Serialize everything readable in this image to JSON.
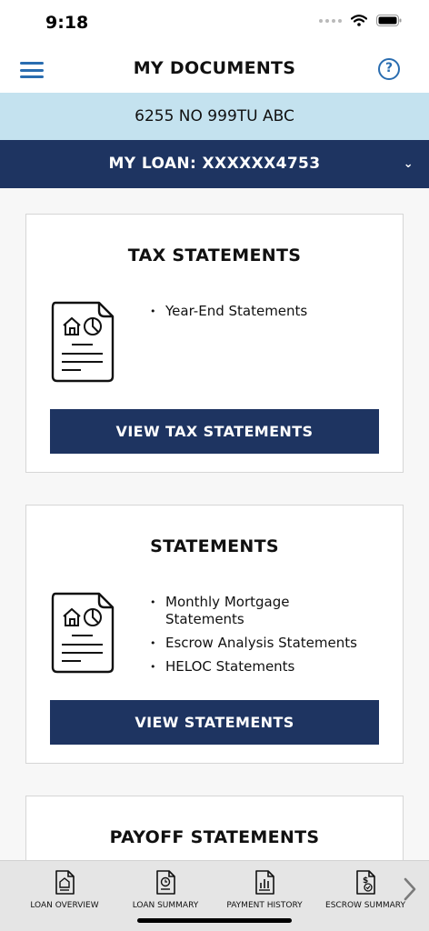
{
  "status_bar": {
    "time": "9:18"
  },
  "nav": {
    "title": "MY DOCUMENTS",
    "help_glyph": "?"
  },
  "address": "6255 NO 999TU ABC",
  "loan": {
    "label": "MY LOAN: XXXXXX4753",
    "chevron": "⌄"
  },
  "cards": [
    {
      "title": "TAX STATEMENTS",
      "items": [
        "Year-End Statements"
      ],
      "button": "VIEW TAX STATEMENTS"
    },
    {
      "title": "STATEMENTS",
      "items": [
        "Monthly Mortgage Statements",
        "Escrow Analysis Statements",
        "HELOC Statements"
      ],
      "button": "VIEW STATEMENTS"
    },
    {
      "title": "PAYOFF STATEMENTS"
    }
  ],
  "tab_bar": {
    "tabs": [
      {
        "label": "LOAN OVERVIEW",
        "icon": "home-document-icon"
      },
      {
        "label": "LOAN SUMMARY",
        "icon": "document-clock-icon"
      },
      {
        "label": "PAYMENT HISTORY",
        "icon": "document-chart-icon"
      },
      {
        "label": "ESCROW SUMMARY",
        "icon": "document-dollar-icon"
      }
    ],
    "next_icon": "chevron-right-icon"
  },
  "colors": {
    "navy": "#1e3461",
    "accent_blue": "#2a6db0",
    "light_blue": "#c4e2ef"
  }
}
